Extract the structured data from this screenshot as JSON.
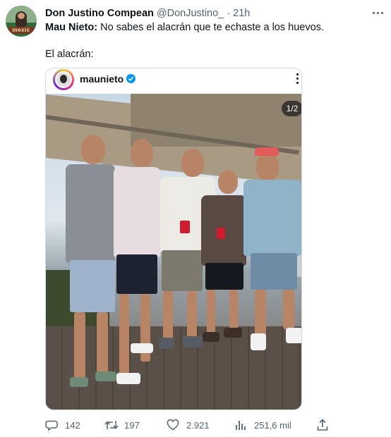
{
  "tweet": {
    "author_name": "Don Justino Compean",
    "handle": "@DonJustino_",
    "separator": "·",
    "time": "21h",
    "avatar_banner": "mexic",
    "quote_speaker": "Mau Nieto:",
    "quote_text": " No sabes el alacrán que te echaste a los huevos.",
    "second_line": "El alacrán:"
  },
  "embedded_post": {
    "username": "maunieto",
    "pager": "1/2"
  },
  "actions": {
    "replies": "142",
    "reposts": "197",
    "likes": "2.921",
    "views": "251,6 mil"
  }
}
